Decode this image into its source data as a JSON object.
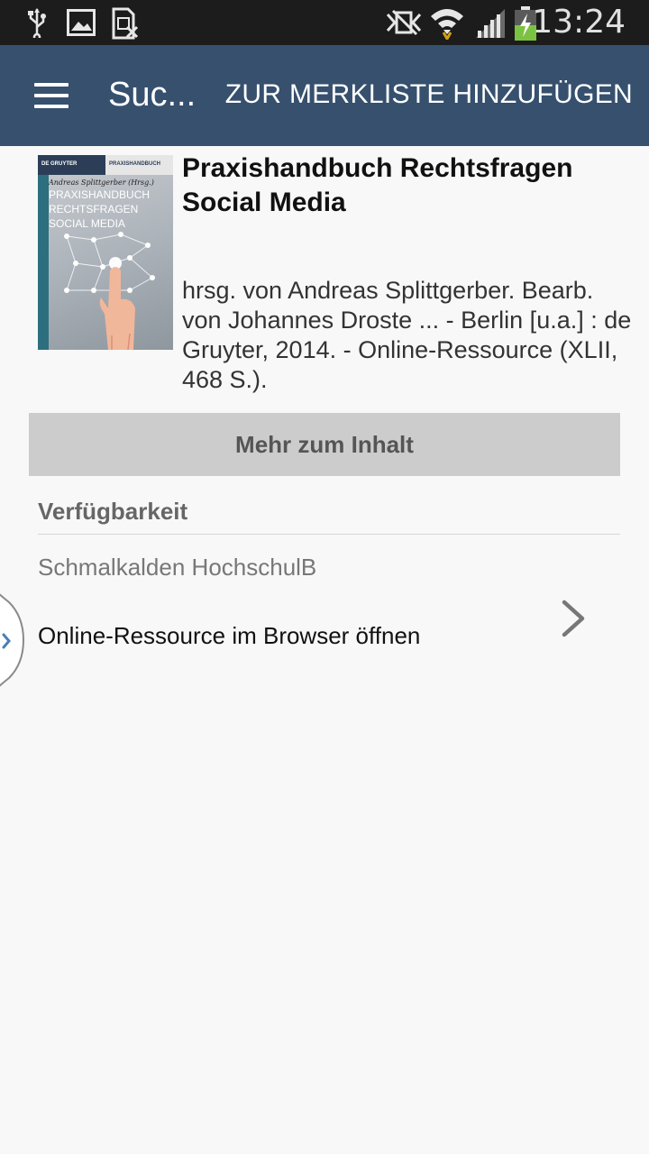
{
  "status_bar": {
    "time": "13:24",
    "icons": [
      "usb-icon",
      "image-icon",
      "sim-missing-icon",
      "nfc-icon",
      "wifi-icon",
      "signal-icon",
      "battery-charging-icon"
    ]
  },
  "action_bar": {
    "menu_icon": "hamburger-menu-icon",
    "title": "Suc...",
    "action_label": "ZUR MERKLISTE HINZUFÜGEN"
  },
  "book": {
    "cover": {
      "publisher": "DE GRUYTER",
      "series": "PRAXISHANDBUCH",
      "author": "Andreas Splittgerber (Hrsg.)",
      "title_line1": "PRAXISHANDBUCH",
      "title_line2": "RECHTSFRAGEN",
      "title_line3": "SOCIAL MEDIA"
    },
    "title": "Praxishandbuch Rechtsfragen Social Media",
    "description": "hrsg. von Andreas Splittgerber. Bearb. von Johannes Droste ... - Berlin [u.a.] : de Gruyter, 2014. - Online-Ressource (XLII, 468 S.)."
  },
  "more_button": {
    "label": "Mehr zum Inhalt"
  },
  "availability": {
    "heading": "Verfügbarkeit",
    "library": "Schmalkalden HochschulB",
    "link_label": "Online-Ressource im Browser öffnen",
    "link_icon": "chevron-right-icon"
  },
  "side_tab": {
    "icon": "chevron-right-icon"
  },
  "colors": {
    "action_bar": "#36506e",
    "status_bar": "#1c1c1c",
    "button_bg": "#cccccc",
    "background": "#f8f8f8"
  }
}
